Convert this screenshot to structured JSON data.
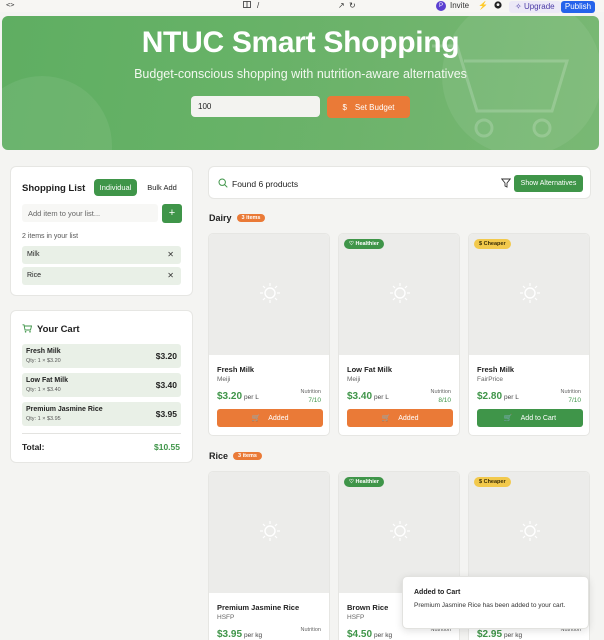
{
  "topbar": {
    "code_icon": "code-brackets-icon",
    "path": "/",
    "avatar_letter": "P",
    "invite": "Invite",
    "upgrade": "Upgrade",
    "publish": "Publish"
  },
  "hero": {
    "title": "NTUC Smart Shopping",
    "subtitle": "Budget-conscious shopping with nutrition-aware alternatives",
    "budget_value": "100",
    "set_budget_label": "Set Budget",
    "budget_icon": "$"
  },
  "shopping_list": {
    "title": "Shopping List",
    "mode_individual": "Individual",
    "mode_bulk": "Bulk Add",
    "add_placeholder": "Add item to your list...",
    "add_button": "+",
    "count_text": "2 items in your list",
    "items": [
      {
        "label": "Milk"
      },
      {
        "label": "Rice"
      }
    ]
  },
  "cart": {
    "title": "Your Cart",
    "items": [
      {
        "name": "Fresh Milk",
        "qty": "Qty: 1 × $3.20",
        "price": "$3.20"
      },
      {
        "name": "Low Fat Milk",
        "qty": "Qty: 1 × $3.40",
        "price": "$3.40"
      },
      {
        "name": "Premium Jasmine Rice",
        "qty": "Qty: 1 × $3.95",
        "price": "$3.95"
      }
    ],
    "total_label": "Total:",
    "total_value": "$10.55"
  },
  "search": {
    "found_text": "Found 6 products",
    "alternatives_label": "Show Alternatives"
  },
  "categories": [
    {
      "name": "Dairy",
      "badge": "3 items",
      "products": [
        {
          "name": "Fresh Milk",
          "brand": "Meiji",
          "price": "$3.20",
          "unit": "per L",
          "nutrition_label": "Nutrition",
          "nutrition": "7/10",
          "tag": "",
          "action": "Added"
        },
        {
          "name": "Low Fat Milk",
          "brand": "Meiji",
          "price": "$3.40",
          "unit": "per L",
          "nutrition_label": "Nutrition",
          "nutrition": "8/10",
          "tag": "Healthier",
          "action": "Added"
        },
        {
          "name": "Fresh Milk",
          "brand": "FairPrice",
          "price": "$2.80",
          "unit": "per L",
          "nutrition_label": "Nutrition",
          "nutrition": "7/10",
          "tag": "Cheaper",
          "action": "Add to Cart"
        }
      ]
    },
    {
      "name": "Rice",
      "badge": "3 items",
      "products": [
        {
          "name": "Premium Jasmine Rice",
          "brand": "HSFP",
          "price": "$3.95",
          "unit": "per kg",
          "nutrition_label": "Nutrition",
          "tag": ""
        },
        {
          "name": "Brown Rice",
          "brand": "HSFP",
          "price": "$4.50",
          "unit": "per kg",
          "nutrition_label": "Nutrition",
          "tag": "Healthier"
        },
        {
          "name": "",
          "brand": "",
          "price": "$2.95",
          "unit": "per kg",
          "nutrition_label": "Nutrition",
          "tag": "Cheaper"
        }
      ]
    }
  ],
  "toast": {
    "title": "Added to Cart",
    "body": "Premium Jasmine Rice has been added to your cart."
  },
  "colors": {
    "brand_green": "#3f9549",
    "accent_orange": "#ea7a37",
    "cheaper_yellow": "#f2c94c"
  }
}
